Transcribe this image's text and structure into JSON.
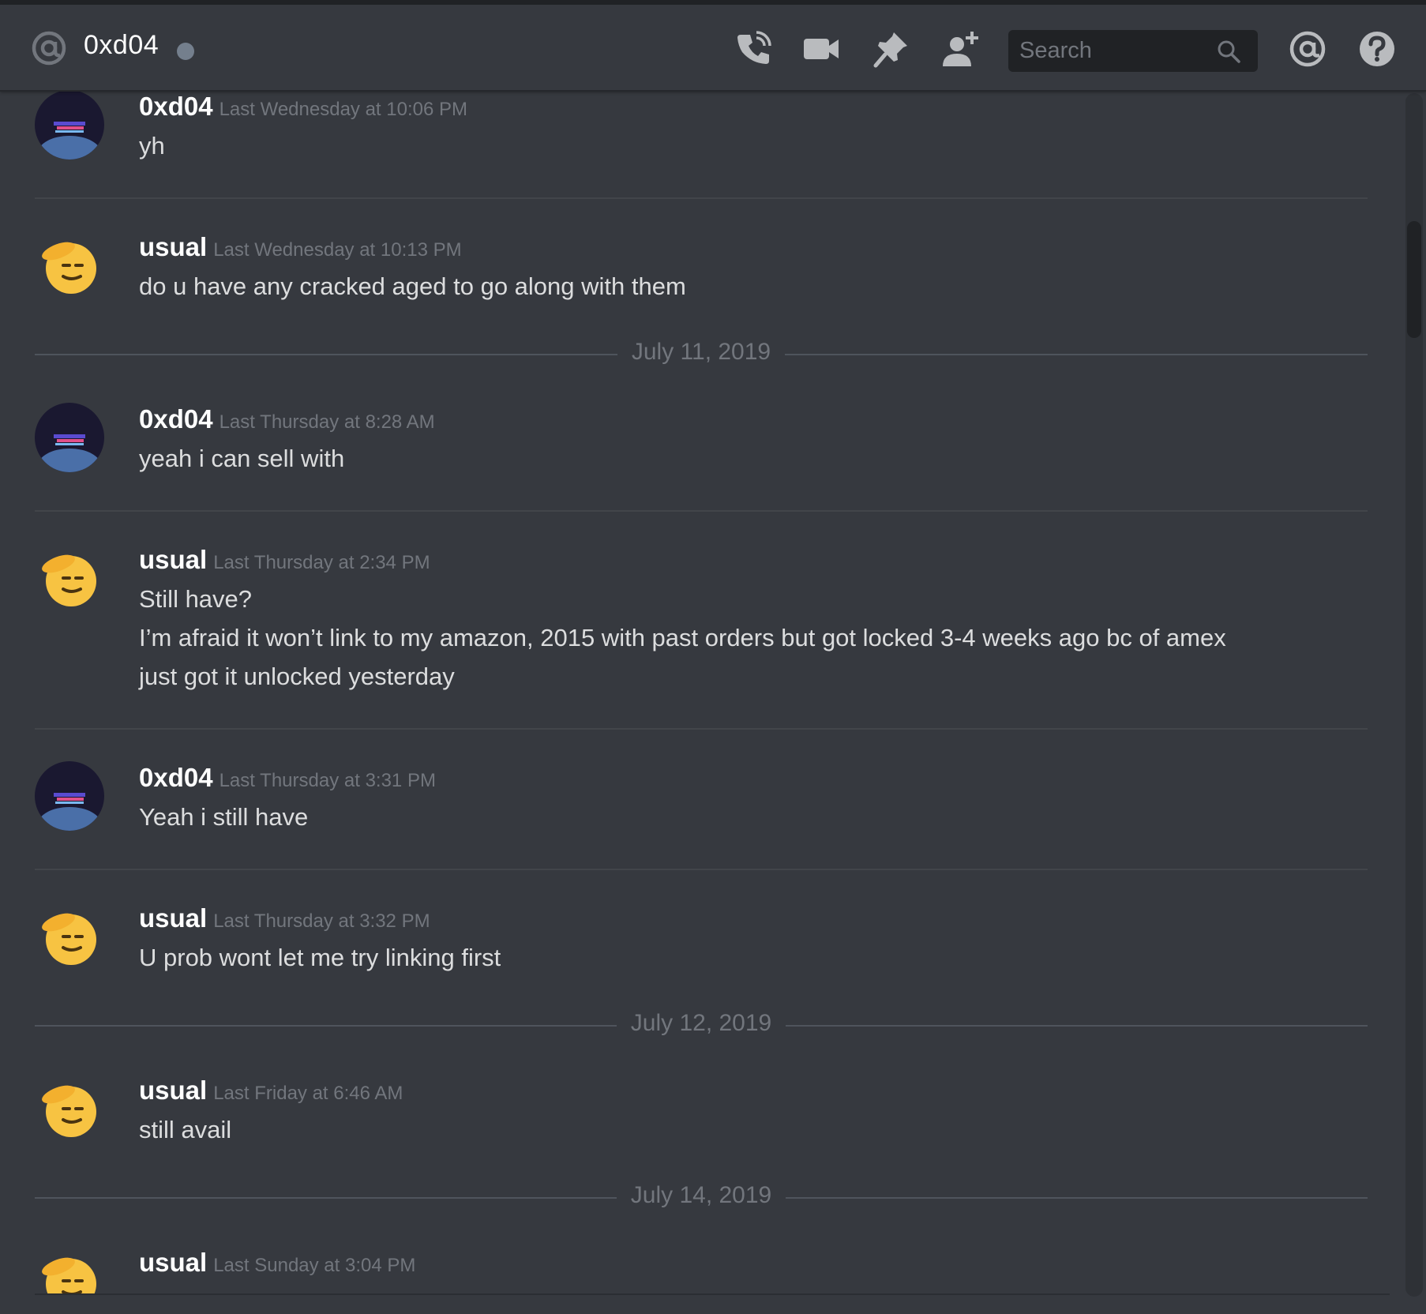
{
  "header": {
    "channel_name": "0xd04",
    "search_placeholder": "Search",
    "icons": [
      "at-icon",
      "voice-call-icon",
      "video-call-icon",
      "pin-icon",
      "add-friend-icon",
      "search-icon",
      "mentions-icon",
      "help-icon"
    ],
    "status_color": "#747f8d"
  },
  "colors": {
    "background": "#36393f",
    "header_bg": "#36393f",
    "search_bg": "#202225",
    "username": "#ffffff",
    "timestamp": "#72767d",
    "text": "#dcddde"
  },
  "messages": [
    {
      "author": "0xd04",
      "avatar": "0xd04-avatar",
      "timestamp": "Last Wednesday at 10:06 PM",
      "lines": [
        "yh"
      ]
    },
    {
      "author": "usual",
      "avatar": "salute-emoji-avatar",
      "timestamp": "Last Wednesday at 10:13 PM",
      "lines": [
        "do u have any cracked aged to go along with them"
      ]
    },
    {
      "date_divider": "July 11, 2019"
    },
    {
      "author": "0xd04",
      "avatar": "0xd04-avatar",
      "timestamp": "Last Thursday at 8:28 AM",
      "lines": [
        "yeah i can sell with"
      ]
    },
    {
      "author": "usual",
      "avatar": "salute-emoji-avatar",
      "timestamp": "Last Thursday at 2:34 PM",
      "lines": [
        "Still have?",
        "I’m afraid it won’t link to my amazon, 2015 with past orders but got locked 3-4 weeks ago bc of amex",
        "just got it unlocked yesterday"
      ]
    },
    {
      "author": "0xd04",
      "avatar": "0xd04-avatar",
      "timestamp": "Last Thursday at 3:31 PM",
      "lines": [
        "Yeah i still have"
      ]
    },
    {
      "author": "usual",
      "avatar": "salute-emoji-avatar",
      "timestamp": "Last Thursday at 3:32 PM",
      "lines": [
        "U prob wont let me try linking first"
      ]
    },
    {
      "date_divider": "July 12, 2019"
    },
    {
      "author": "usual",
      "avatar": "salute-emoji-avatar",
      "timestamp": "Last Friday at 6:46 AM",
      "lines": [
        "still avail"
      ]
    },
    {
      "date_divider": "July 14, 2019"
    },
    {
      "author": "usual",
      "avatar": "salute-emoji-avatar",
      "timestamp": "Last Sunday at 3:04 PM",
      "lines": []
    }
  ]
}
